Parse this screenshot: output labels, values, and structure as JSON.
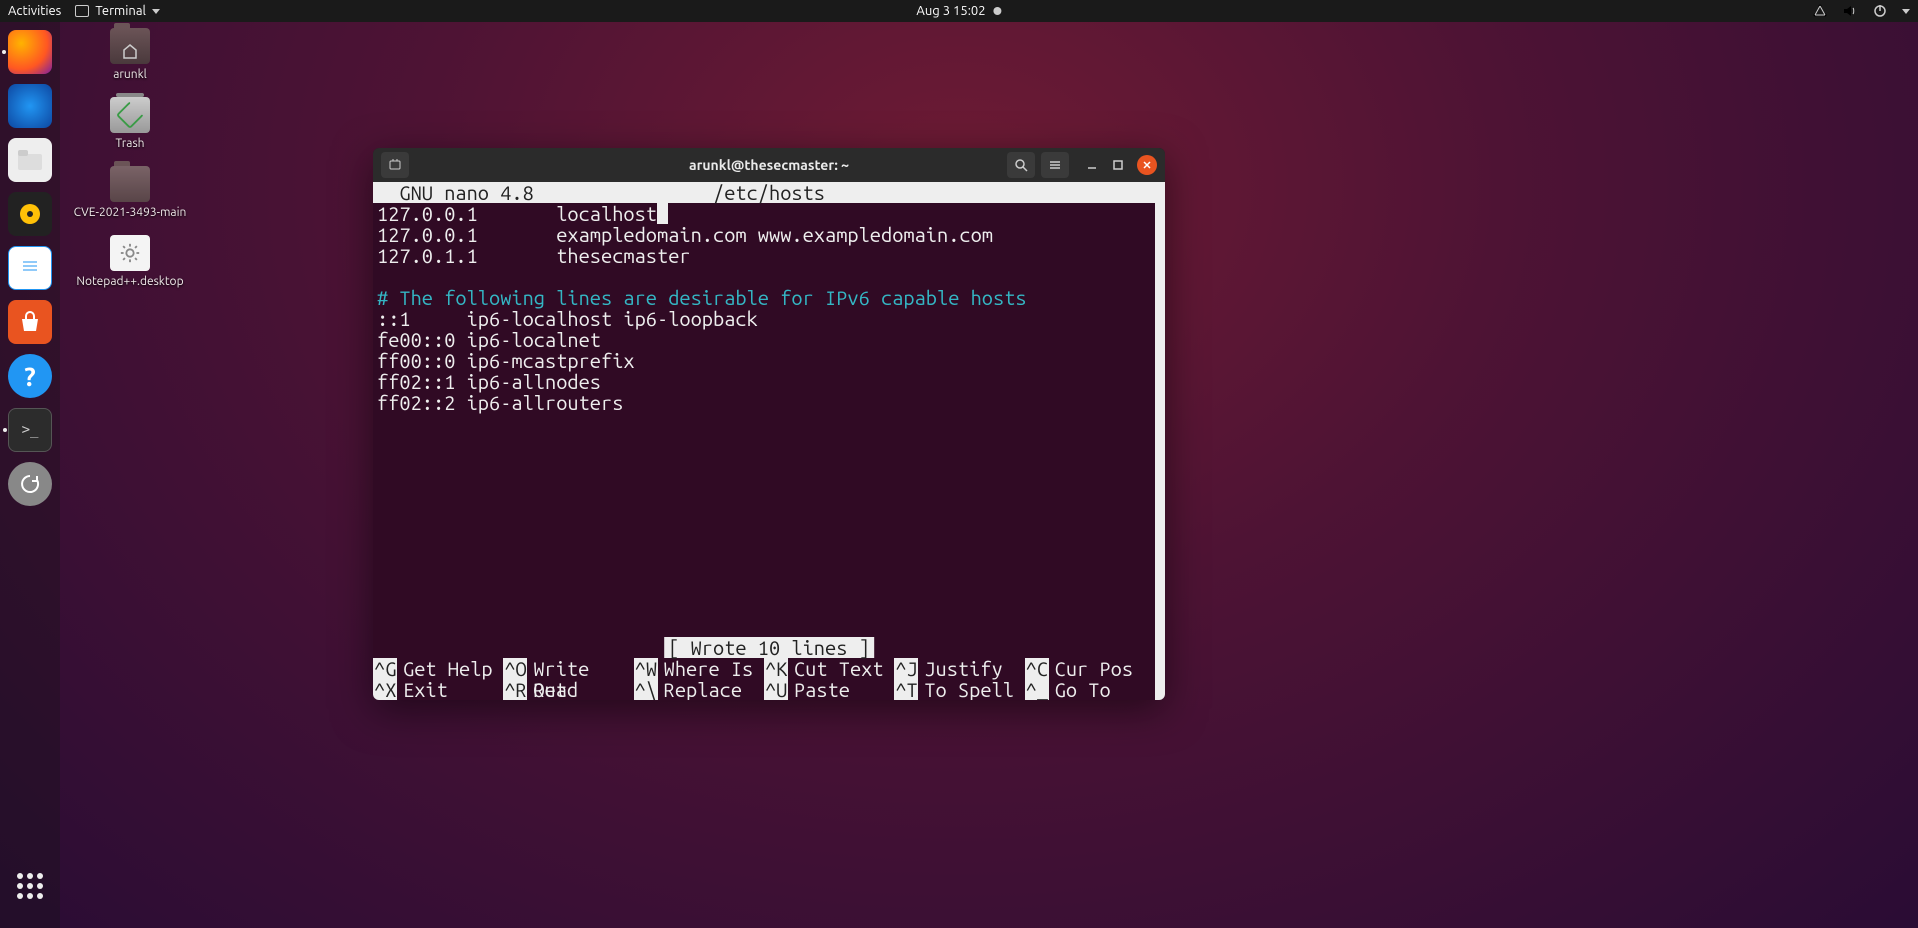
{
  "topbar": {
    "activities": "Activities",
    "app_menu": "Terminal",
    "datetime": "Aug 3  15:02"
  },
  "desktop_icons": [
    {
      "label": "arunkl",
      "kind": "home-folder"
    },
    {
      "label": "Trash",
      "kind": "trash"
    },
    {
      "label": "CVE-2021-3493-main",
      "kind": "folder"
    },
    {
      "label": "Notepad++.desktop",
      "kind": "launcher"
    }
  ],
  "dock": {
    "apps": [
      "firefox",
      "thunderbird",
      "files",
      "rhythmbox",
      "writer",
      "software",
      "help",
      "terminal",
      "updater"
    ],
    "active": "terminal"
  },
  "terminal": {
    "title": "arunkl@thesecmaster: ~",
    "editor_name": "GNU nano 4.8",
    "file_path": "/etc/hosts",
    "lines": [
      {
        "text": "127.0.0.1       localhost",
        "cursor_after": true
      },
      {
        "text": "127.0.0.1       exampledomain.com www.exampledomain.com"
      },
      {
        "text": "127.0.1.1       thesecmaster"
      },
      {
        "text": ""
      },
      {
        "text": "# The following lines are desirable for IPv6 capable hosts",
        "comment": true
      },
      {
        "text": "::1     ip6-localhost ip6-loopback"
      },
      {
        "text": "fe00::0 ip6-localnet"
      },
      {
        "text": "ff00::0 ip6-mcastprefix"
      },
      {
        "text": "ff02::1 ip6-allnodes"
      },
      {
        "text": "ff02::2 ip6-allrouters"
      }
    ],
    "status": "[ Wrote 10 lines ]",
    "help": [
      {
        "key": "^G",
        "label": "Get Help"
      },
      {
        "key": "^O",
        "label": "Write Out"
      },
      {
        "key": "^W",
        "label": "Where Is"
      },
      {
        "key": "^K",
        "label": "Cut Text"
      },
      {
        "key": "^J",
        "label": "Justify"
      },
      {
        "key": "^C",
        "label": "Cur Pos"
      },
      {
        "key": "^X",
        "label": "Exit"
      },
      {
        "key": "^R",
        "label": "Read File"
      },
      {
        "key": "^\\",
        "label": "Replace"
      },
      {
        "key": "^U",
        "label": "Paste Text"
      },
      {
        "key": "^T",
        "label": "To Spell"
      },
      {
        "key": "^_",
        "label": "Go To Line"
      }
    ]
  }
}
